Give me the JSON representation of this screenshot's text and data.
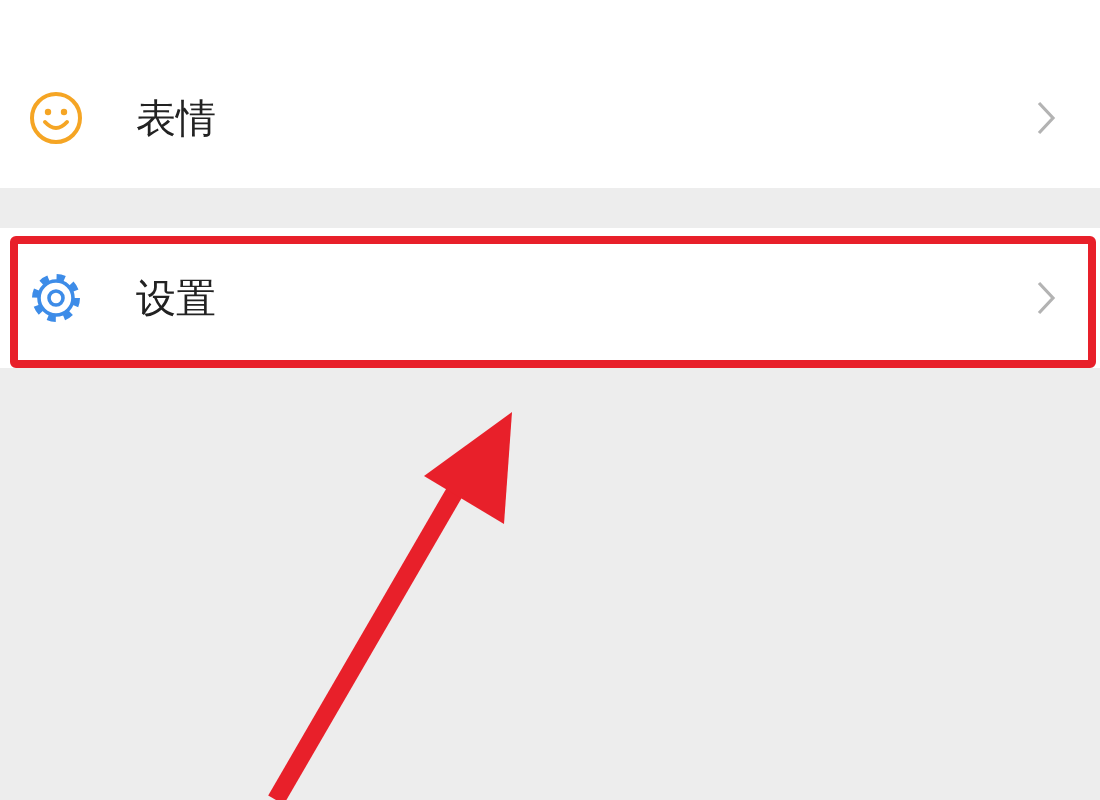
{
  "sections": [
    {
      "rows": [
        {
          "label": "表情",
          "kind": "emoji",
          "highlighted": false
        }
      ]
    },
    {
      "rows": [
        {
          "label": "设置",
          "kind": "settings",
          "highlighted": true
        }
      ]
    }
  ],
  "annotation": {
    "kind": "arrow"
  }
}
